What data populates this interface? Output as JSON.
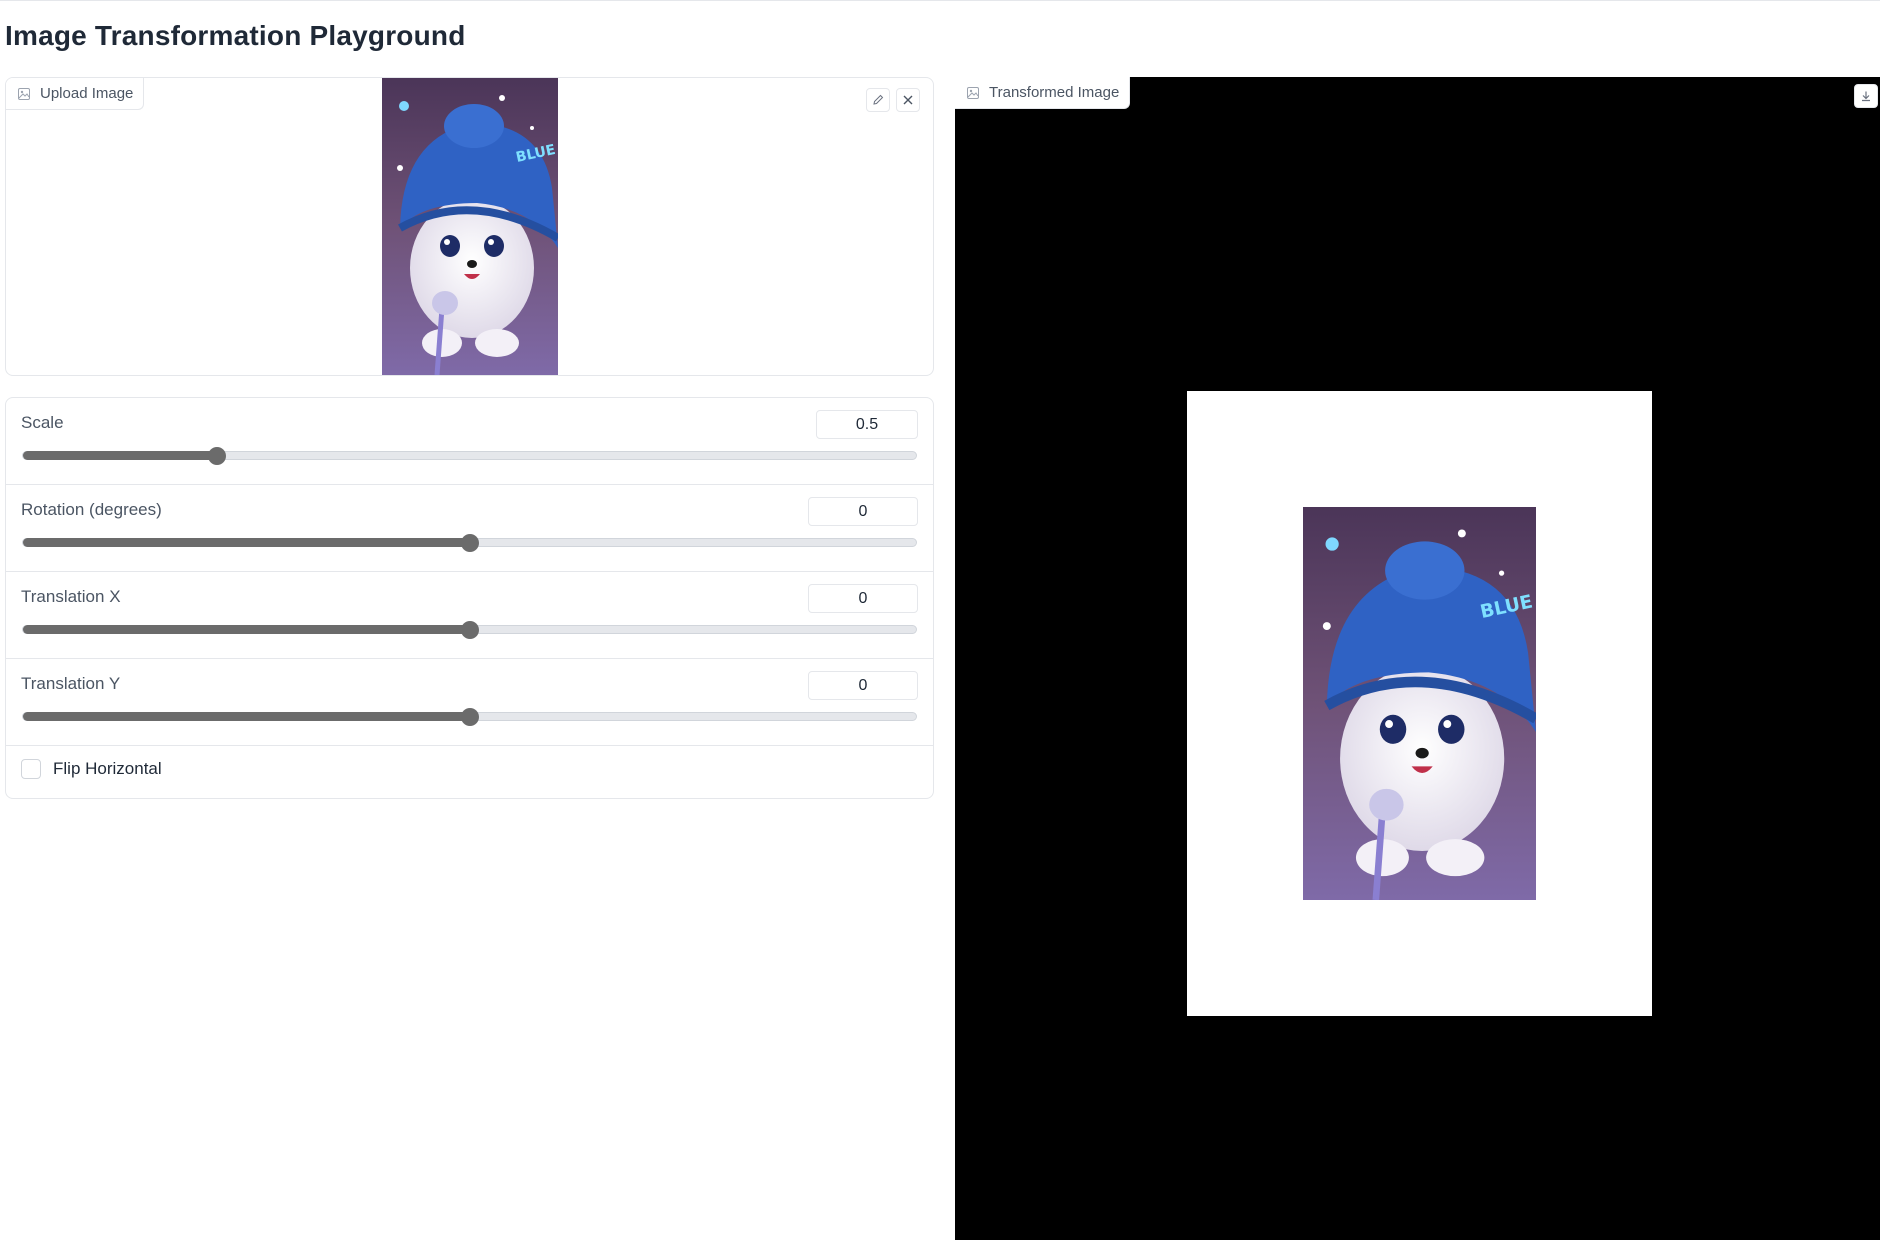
{
  "page": {
    "title": "Image Transformation Playground"
  },
  "upload": {
    "label": "Upload Image",
    "icon": "image-icon",
    "tools": [
      "pencil-icon",
      "close-icon"
    ]
  },
  "controls": {
    "scale": {
      "label": "Scale",
      "value": "0.5",
      "fraction": 0.2167
    },
    "rotation": {
      "label": "Rotation (degrees)",
      "value": "0",
      "fraction": 0.5
    },
    "translation_x": {
      "label": "Translation X",
      "value": "0",
      "fraction": 0.5
    },
    "translation_y": {
      "label": "Translation Y",
      "value": "0",
      "fraction": 0.5
    },
    "flip": {
      "label": "Flip Horizontal",
      "checked": false
    }
  },
  "output": {
    "label": "Transformed Image",
    "icon": "image-icon",
    "download_icon": "download-icon"
  },
  "colors": {
    "slider_fill": "#6b6b6b",
    "output_background": "#000000",
    "image_hat": "#2f62c4"
  }
}
